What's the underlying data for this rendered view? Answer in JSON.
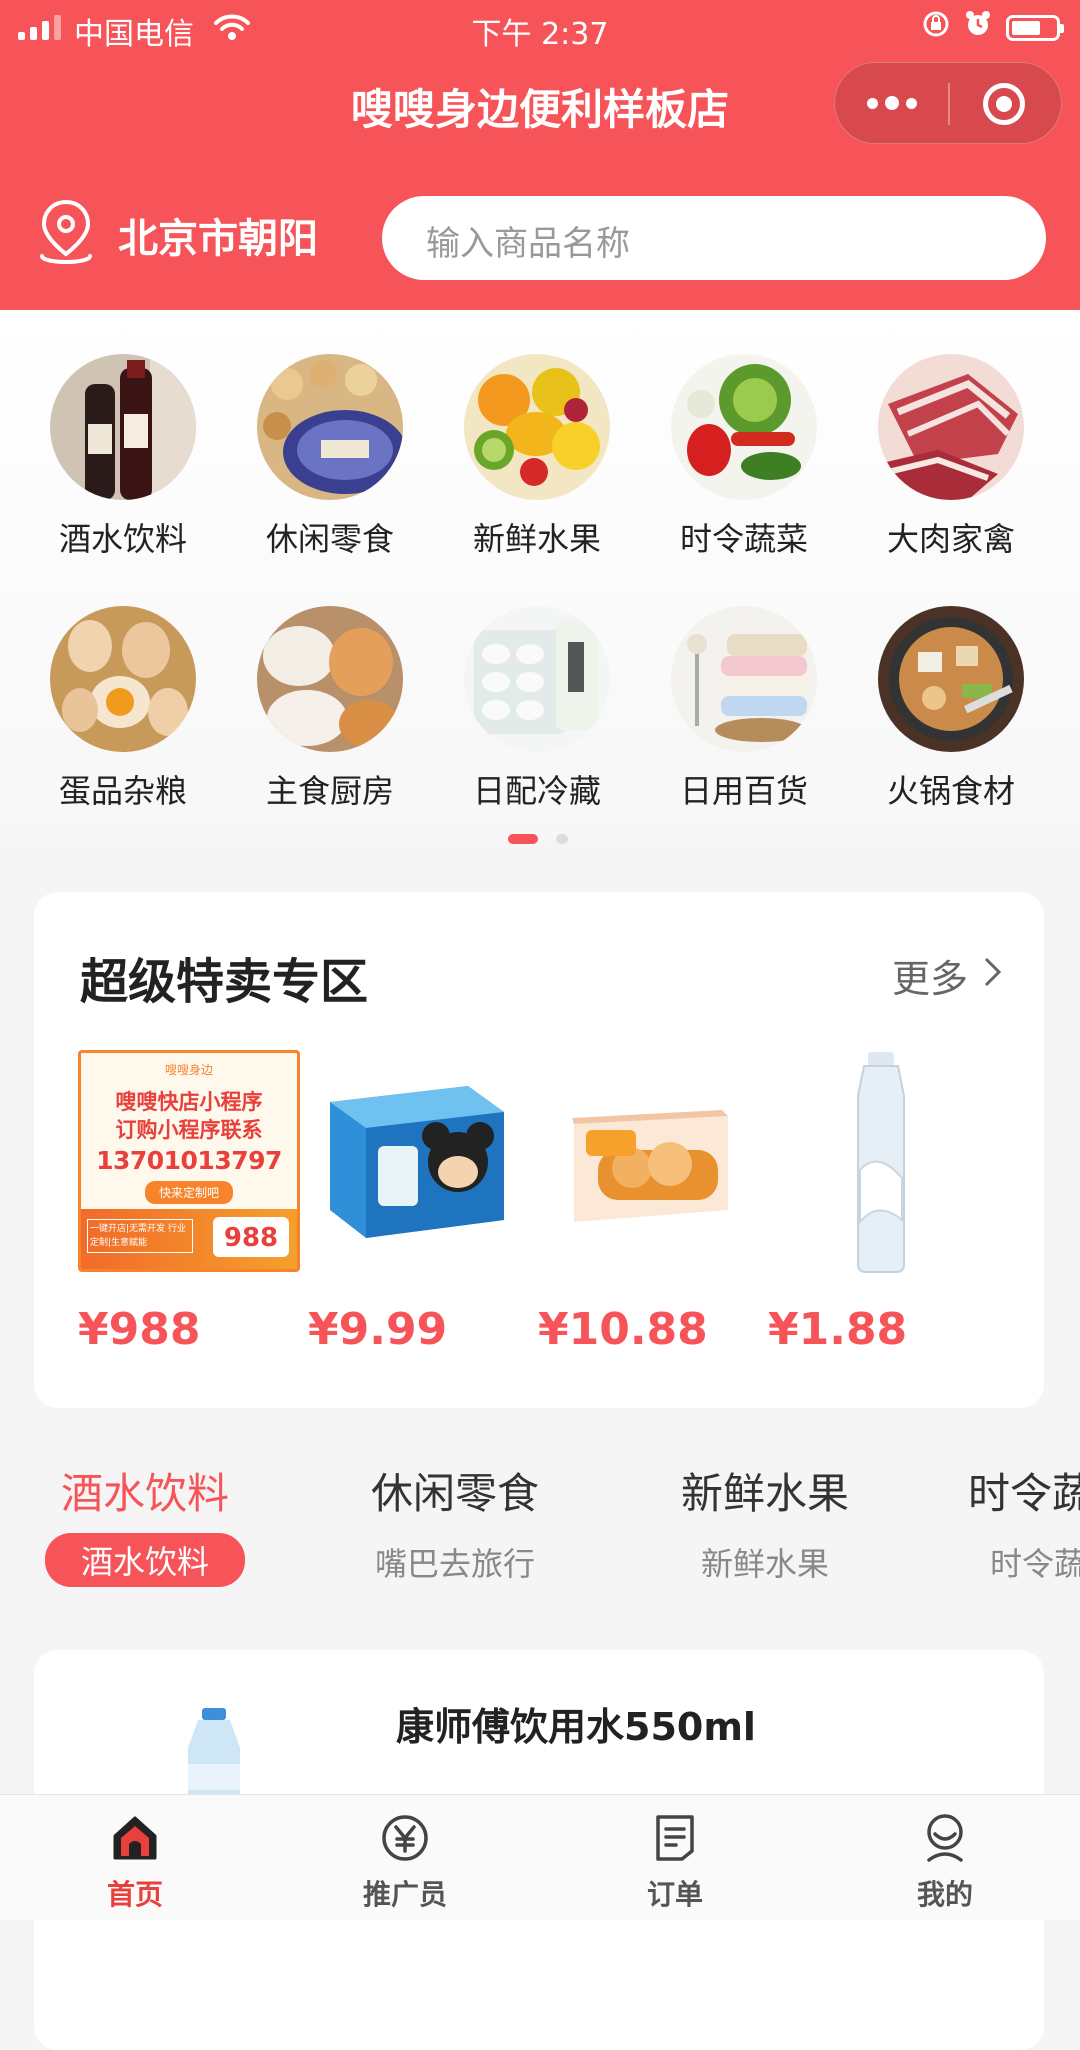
{
  "status_bar": {
    "carrier": "中国电信",
    "time": "下午 2:37"
  },
  "header": {
    "title": "嗖嗖身边便利样板店",
    "location": "北京市朝阳",
    "search_placeholder": "输入商品名称"
  },
  "categories": [
    {
      "label": "酒水饮料",
      "icon": "wine-bottles"
    },
    {
      "label": "休闲零食",
      "icon": "cookie-tin"
    },
    {
      "label": "新鲜水果",
      "icon": "fruit-bowl"
    },
    {
      "label": "时令蔬菜",
      "icon": "vegetables"
    },
    {
      "label": "大肉家禽",
      "icon": "pork-meat"
    },
    {
      "label": "蛋品杂粮",
      "icon": "eggs"
    },
    {
      "label": "主食厨房",
      "icon": "steamed-buns"
    },
    {
      "label": "日配冷藏",
      "icon": "frozen-dumplings"
    },
    {
      "label": "日用百货",
      "icon": "towels"
    },
    {
      "label": "火锅食材",
      "icon": "hotpot"
    }
  ],
  "pager": {
    "pages": 2,
    "current": 1
  },
  "special_sale": {
    "title": "超级特卖专区",
    "more_label": "更多",
    "products": [
      {
        "price": "¥988",
        "image": "ad-poster",
        "ad": {
          "brand": "嗖嗖身边",
          "line1": "嗖嗖快店小程序",
          "line2": "订购小程序联系",
          "phone": "13701013797",
          "tag": "快来定制吧",
          "small": "一键开店|无需开发 行业定制|生意赋能",
          "num": "988"
        }
      },
      {
        "price": "¥9.99",
        "image": "mickey-icecream-box"
      },
      {
        "price": "¥10.88",
        "image": "cracker-box"
      },
      {
        "price": "¥1.88",
        "image": "water-bottle"
      }
    ]
  },
  "category_tabs": [
    {
      "title": "酒水饮料",
      "subtitle": "酒水饮料",
      "active": true
    },
    {
      "title": "休闲零食",
      "subtitle": "嘴巴去旅行",
      "active": false
    },
    {
      "title": "新鲜水果",
      "subtitle": "新鲜水果",
      "active": false
    },
    {
      "title": "时令蔬菜",
      "subtitle": "时令蔬菜",
      "active": false
    }
  ],
  "product_list": [
    {
      "name": "康师傅饮用水550ml"
    }
  ],
  "tabbar": [
    {
      "label": "首页",
      "icon": "home-icon",
      "active": true
    },
    {
      "label": "推广员",
      "icon": "yen-icon",
      "active": false
    },
    {
      "label": "订单",
      "icon": "order-icon",
      "active": false
    },
    {
      "label": "我的",
      "icon": "profile-icon",
      "active": false
    }
  ],
  "colors": {
    "brand_red": "#f65458",
    "price_red": "#f65458",
    "background": "#f5f5f5"
  }
}
